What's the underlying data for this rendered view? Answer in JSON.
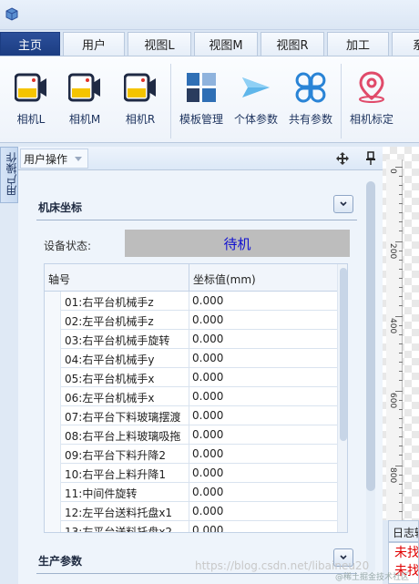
{
  "tabs": [
    "主页",
    "用户",
    "视图L",
    "视图M",
    "视图R",
    "加工",
    "系"
  ],
  "ribbon": [
    {
      "label": "相机L",
      "icon": "camera-icon"
    },
    {
      "label": "相机M",
      "icon": "camera-icon"
    },
    {
      "label": "相机R",
      "icon": "camera-icon"
    },
    {
      "label": "模板管理",
      "icon": "template-grid-icon"
    },
    {
      "label": "个体参数",
      "icon": "send-arrow-icon"
    },
    {
      "label": "共有参数",
      "icon": "clover-icon"
    },
    {
      "label": "相机标定",
      "icon": "location-pin-icon"
    }
  ],
  "side_tab": "用户操作",
  "panel": {
    "dropdown": "用户操作"
  },
  "machine_group": {
    "title": "机床坐标",
    "status_label": "设备状态:",
    "status_value": "待机",
    "columns": [
      "轴号",
      "坐标值(mm)"
    ],
    "rows": [
      {
        "axis": "01:右平台机械手z",
        "value": "0.000"
      },
      {
        "axis": "02:左平台机械手z",
        "value": "0.000"
      },
      {
        "axis": "03:右平台机械手旋转",
        "value": "0.000"
      },
      {
        "axis": "04:右平台机械手y",
        "value": "0.000"
      },
      {
        "axis": "05:右平台机械手x",
        "value": "0.000"
      },
      {
        "axis": "06:左平台机械手x",
        "value": "0.000"
      },
      {
        "axis": "07:右平台下料玻璃摆渡",
        "value": "0.000"
      },
      {
        "axis": "08:右平台上料玻璃吸拖",
        "value": "0.000"
      },
      {
        "axis": "09:右平台下料升降2",
        "value": "0.000"
      },
      {
        "axis": "10:右平台上料升降1",
        "value": "0.000"
      },
      {
        "axis": "11:中间件旋转",
        "value": "0.000"
      },
      {
        "axis": "12:左平台送料托盘x1",
        "value": "0.000"
      },
      {
        "axis": "13:左平台送料托盘x2",
        "value": "0.000"
      }
    ]
  },
  "production_group": {
    "title": "生产参数"
  },
  "ruler": [
    "0",
    "200",
    "400",
    "600",
    "800"
  ],
  "log": {
    "tab": "日志输",
    "lines": [
      "未找",
      "未找"
    ]
  },
  "watermark": "https://blog.csdn.net/libaineu20",
  "watermark2": "@稀土掘金技术社区",
  "colors": {
    "active_tab": "#1c3d82",
    "status_bg": "#bdbdbd",
    "status_text": "#1010d0",
    "log_text": "#e00000"
  }
}
